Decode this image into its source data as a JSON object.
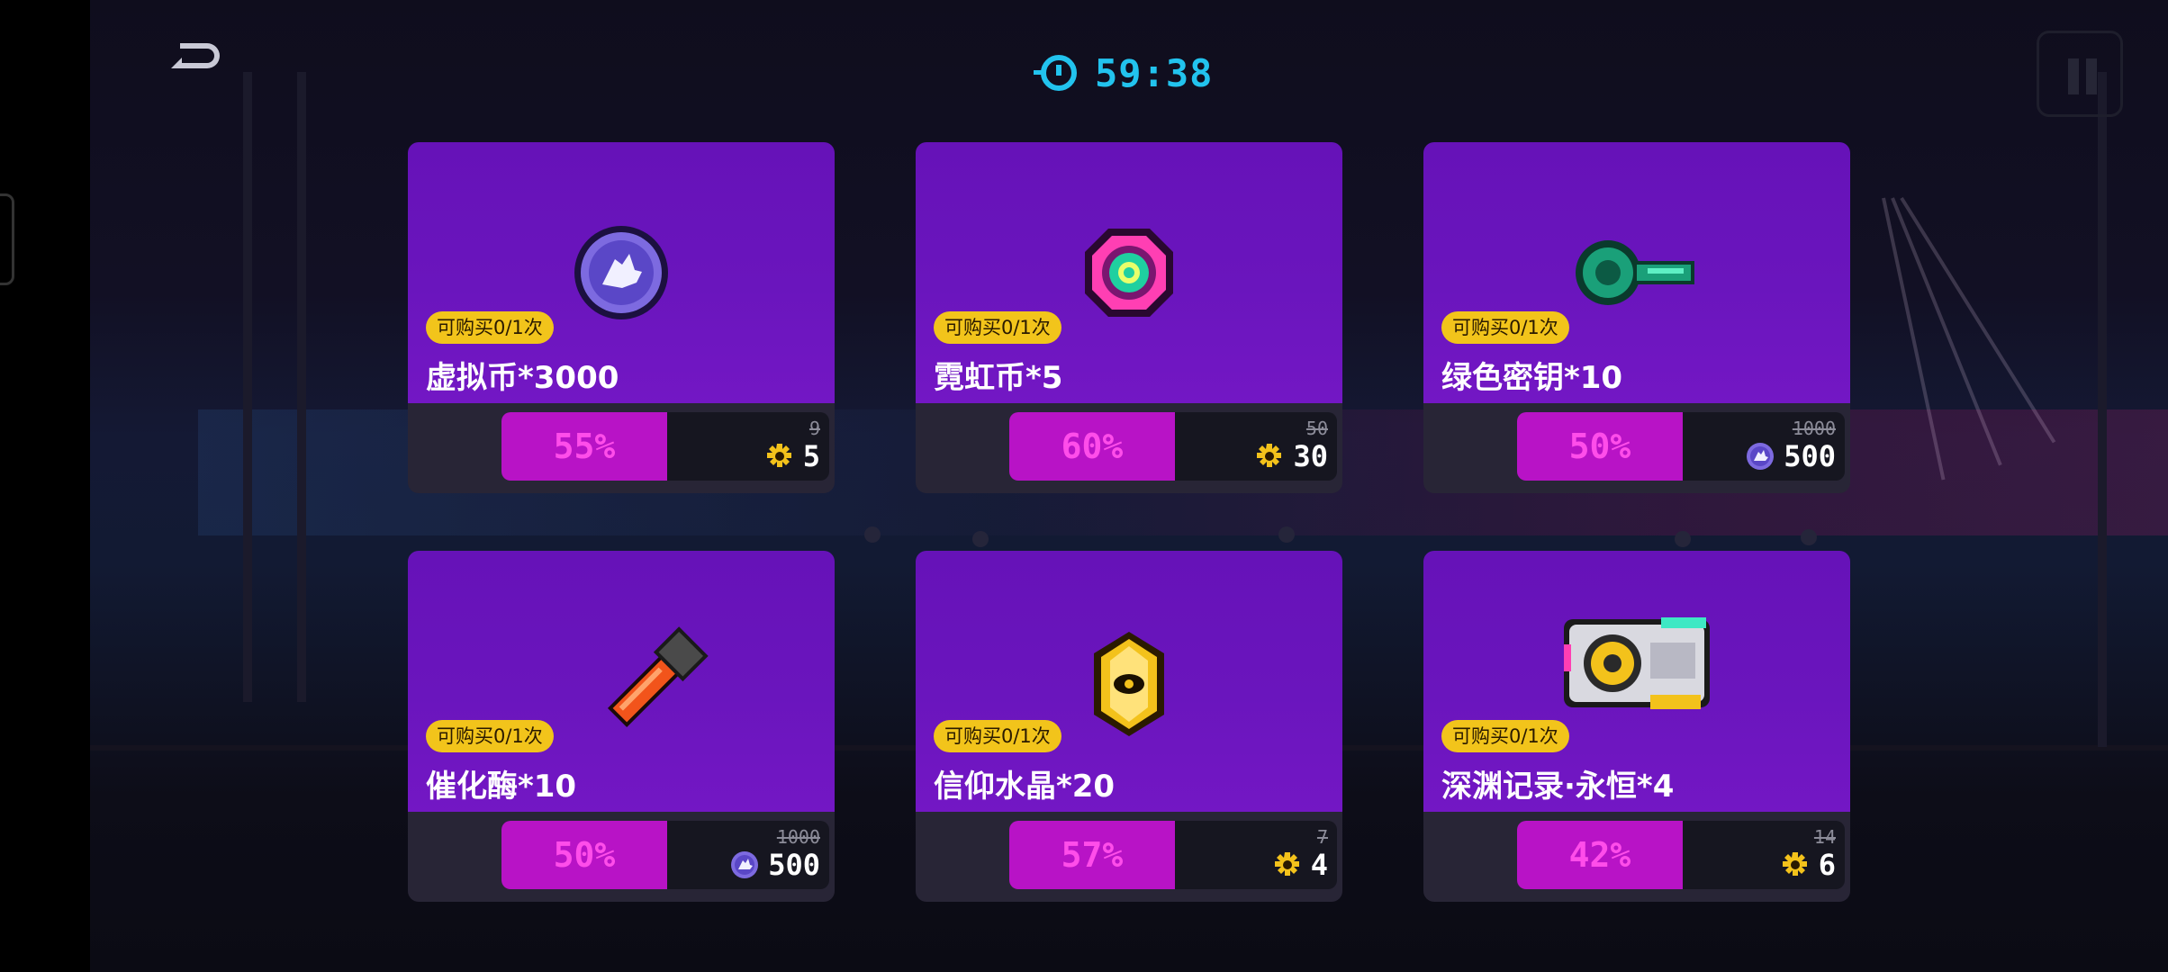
{
  "timer": {
    "value": "59:38"
  },
  "colors": {
    "accent": "#22c3ee",
    "card": "#6a15bd",
    "badge": "#f2c41b",
    "discount": "#b813c6"
  },
  "cards": [
    {
      "name": "虚拟币*3000",
      "limit": "可购买0/1次",
      "discount": "55%",
      "original_price": "9",
      "price": "5",
      "currency": "gold-gear-icon",
      "icon": "virtual-coin-icon"
    },
    {
      "name": "霓虹币*5",
      "limit": "可购买0/1次",
      "discount": "60%",
      "original_price": "50",
      "price": "30",
      "currency": "gold-gear-icon",
      "icon": "neon-coin-icon"
    },
    {
      "name": "绿色密钥*10",
      "limit": "可购买0/1次",
      "discount": "50%",
      "original_price": "1000",
      "price": "500",
      "currency": "virtual-coin-icon",
      "icon": "green-key-icon"
    },
    {
      "name": "催化酶*10",
      "limit": "可购买0/1次",
      "discount": "50%",
      "original_price": "1000",
      "price": "500",
      "currency": "virtual-coin-icon",
      "icon": "catalyst-tube-icon"
    },
    {
      "name": "信仰水晶*20",
      "limit": "可购买0/1次",
      "discount": "57%",
      "original_price": "7",
      "price": "4",
      "currency": "gold-gear-icon",
      "icon": "faith-crystal-icon"
    },
    {
      "name": "深渊记录·永恒*4",
      "limit": "可购买0/1次",
      "discount": "42%",
      "original_price": "14",
      "price": "6",
      "currency": "gold-gear-icon",
      "icon": "abyss-record-icon"
    }
  ]
}
